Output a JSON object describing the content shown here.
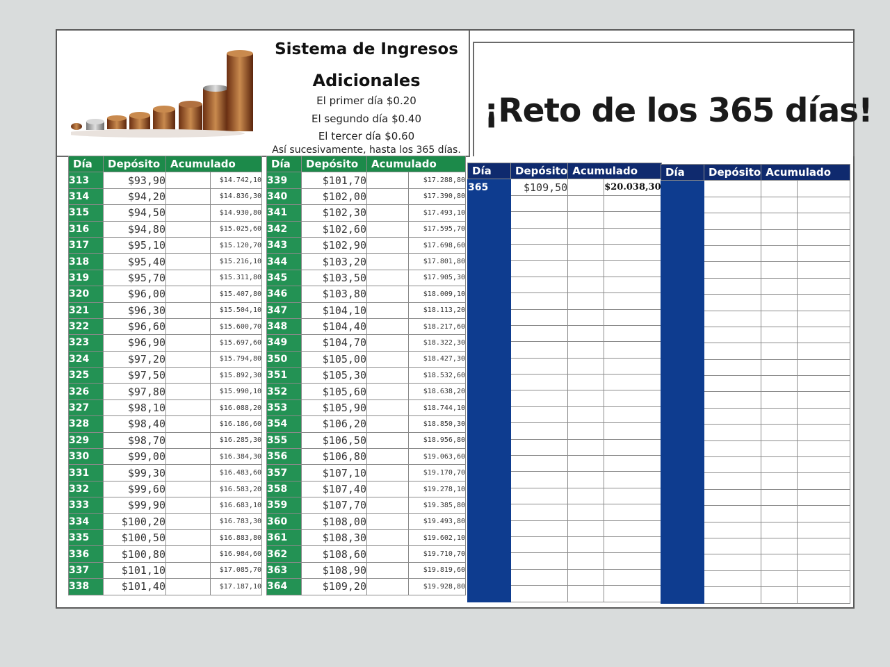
{
  "header": {
    "title_line1": "Sistema de Ingresos",
    "title_line2": "Adicionales",
    "day1": "El primer día $0.20",
    "day2": "El segundo día $0.40",
    "day3": "El tercer día $0.60",
    "note": "Así sucesivamente, hasta los 365 días.",
    "big_title": "¡Reto de los 365 días!"
  },
  "columns": {
    "dia": "Día",
    "deposito": "Depósito",
    "acumulado": "Acumulado"
  },
  "table1": [
    {
      "dia": "313",
      "dep": "$93,90",
      "acc": "$14.742,10"
    },
    {
      "dia": "314",
      "dep": "$94,20",
      "acc": "$14.836,30"
    },
    {
      "dia": "315",
      "dep": "$94,50",
      "acc": "$14.930,80"
    },
    {
      "dia": "316",
      "dep": "$94,80",
      "acc": "$15.025,60"
    },
    {
      "dia": "317",
      "dep": "$95,10",
      "acc": "$15.120,70"
    },
    {
      "dia": "318",
      "dep": "$95,40",
      "acc": "$15.216,10"
    },
    {
      "dia": "319",
      "dep": "$95,70",
      "acc": "$15.311,80"
    },
    {
      "dia": "320",
      "dep": "$96,00",
      "acc": "$15.407,80"
    },
    {
      "dia": "321",
      "dep": "$96,30",
      "acc": "$15.504,10"
    },
    {
      "dia": "322",
      "dep": "$96,60",
      "acc": "$15.600,70"
    },
    {
      "dia": "323",
      "dep": "$96,90",
      "acc": "$15.697,60"
    },
    {
      "dia": "324",
      "dep": "$97,20",
      "acc": "$15.794,80"
    },
    {
      "dia": "325",
      "dep": "$97,50",
      "acc": "$15.892,30"
    },
    {
      "dia": "326",
      "dep": "$97,80",
      "acc": "$15.990,10"
    },
    {
      "dia": "327",
      "dep": "$98,10",
      "acc": "$16.088,20"
    },
    {
      "dia": "328",
      "dep": "$98,40",
      "acc": "$16.186,60"
    },
    {
      "dia": "329",
      "dep": "$98,70",
      "acc": "$16.285,30"
    },
    {
      "dia": "330",
      "dep": "$99,00",
      "acc": "$16.384,30"
    },
    {
      "dia": "331",
      "dep": "$99,30",
      "acc": "$16.483,60"
    },
    {
      "dia": "332",
      "dep": "$99,60",
      "acc": "$16.583,20"
    },
    {
      "dia": "333",
      "dep": "$99,90",
      "acc": "$16.683,10"
    },
    {
      "dia": "334",
      "dep": "$100,20",
      "acc": "$16.783,30"
    },
    {
      "dia": "335",
      "dep": "$100,50",
      "acc": "$16.883,80"
    },
    {
      "dia": "336",
      "dep": "$100,80",
      "acc": "$16.984,60"
    },
    {
      "dia": "337",
      "dep": "$101,10",
      "acc": "$17.085,70"
    },
    {
      "dia": "338",
      "dep": "$101,40",
      "acc": "$17.187,10"
    }
  ],
  "table2": [
    {
      "dia": "339",
      "dep": "$101,70",
      "acc": "$17.288,80"
    },
    {
      "dia": "340",
      "dep": "$102,00",
      "acc": "$17.390,80"
    },
    {
      "dia": "341",
      "dep": "$102,30",
      "acc": "$17.493,10"
    },
    {
      "dia": "342",
      "dep": "$102,60",
      "acc": "$17.595,70"
    },
    {
      "dia": "343",
      "dep": "$102,90",
      "acc": "$17.698,60"
    },
    {
      "dia": "344",
      "dep": "$103,20",
      "acc": "$17.801,80"
    },
    {
      "dia": "345",
      "dep": "$103,50",
      "acc": "$17.905,30"
    },
    {
      "dia": "346",
      "dep": "$103,80",
      "acc": "$18.009,10"
    },
    {
      "dia": "347",
      "dep": "$104,10",
      "acc": "$18.113,20"
    },
    {
      "dia": "348",
      "dep": "$104,40",
      "acc": "$18.217,60"
    },
    {
      "dia": "349",
      "dep": "$104,70",
      "acc": "$18.322,30"
    },
    {
      "dia": "350",
      "dep": "$105,00",
      "acc": "$18.427,30"
    },
    {
      "dia": "351",
      "dep": "$105,30",
      "acc": "$18.532,60"
    },
    {
      "dia": "352",
      "dep": "$105,60",
      "acc": "$18.638,20"
    },
    {
      "dia": "353",
      "dep": "$105,90",
      "acc": "$18.744,10"
    },
    {
      "dia": "354",
      "dep": "$106,20",
      "acc": "$18.850,30"
    },
    {
      "dia": "355",
      "dep": "$106,50",
      "acc": "$18.956,80"
    },
    {
      "dia": "356",
      "dep": "$106,80",
      "acc": "$19.063,60"
    },
    {
      "dia": "357",
      "dep": "$107,10",
      "acc": "$19.170,70"
    },
    {
      "dia": "358",
      "dep": "$107,40",
      "acc": "$19.278,10"
    },
    {
      "dia": "359",
      "dep": "$107,70",
      "acc": "$19.385,80"
    },
    {
      "dia": "360",
      "dep": "$108,00",
      "acc": "$19.493,80"
    },
    {
      "dia": "361",
      "dep": "$108,30",
      "acc": "$19.602,10"
    },
    {
      "dia": "362",
      "dep": "$108,60",
      "acc": "$19.710,70"
    },
    {
      "dia": "363",
      "dep": "$108,90",
      "acc": "$19.819,60"
    },
    {
      "dia": "364",
      "dep": "$109,20",
      "acc": "$19.928,80"
    }
  ],
  "table3": [
    {
      "dia": "365",
      "dep": "$109,50",
      "acc": "$20.038,30"
    }
  ],
  "colors": {
    "green_header": "#1c8a4a",
    "blue_header": "#0f2a6e",
    "blue_column": "#0e3c8f"
  }
}
